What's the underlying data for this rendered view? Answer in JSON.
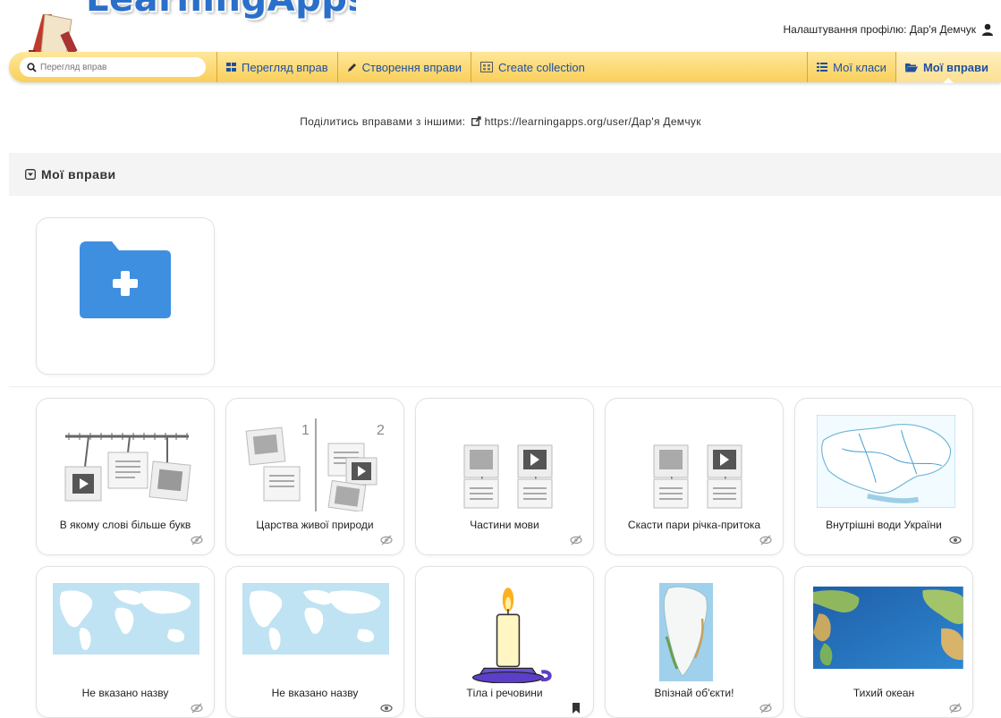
{
  "header": {
    "logo_text": "LearningApps.org",
    "profile_label": "Налаштування профілю: Дар'я Демчук"
  },
  "nav": {
    "search_placeholder": "Перегляд вправ",
    "items": [
      {
        "label": "Перегляд вправ",
        "icon": "grid-icon"
      },
      {
        "label": "Створення вправи",
        "icon": "pencil-icon"
      },
      {
        "label": "Create collection",
        "icon": "collection-icon"
      },
      {
        "label": "Мої класи",
        "icon": "list-icon"
      },
      {
        "label": "Мої вправи",
        "icon": "folder-open-icon",
        "active": true
      }
    ]
  },
  "share": {
    "text": "Поділитись вправами з іншими:",
    "url": "https://learningapps.org/user/Дар'я Демчук"
  },
  "section": {
    "title": "Мої вправи"
  },
  "cards": [
    {
      "title": "В якому слові більше букв",
      "status": "eye-hidden-icon",
      "thumb": "timeline"
    },
    {
      "title": "Царства живої природи",
      "status": "eye-hidden-icon",
      "thumb": "groups"
    },
    {
      "title": "Частини мови",
      "status": "eye-hidden-icon",
      "thumb": "pairs"
    },
    {
      "title": "Скасти пари річка-притока",
      "status": "eye-hidden-icon",
      "thumb": "pairs"
    },
    {
      "title": "Внутрішні води України",
      "status": "eye-icon",
      "thumb": "map-ukraine"
    },
    {
      "title": "Не вказано назву",
      "status": "eye-hidden-icon",
      "thumb": "world-map"
    },
    {
      "title": "Не вказано назву",
      "status": "eye-icon",
      "thumb": "world-map"
    },
    {
      "title": "Тіла і речовини",
      "status": "bookmark-icon",
      "thumb": "candle"
    },
    {
      "title": "Впізнай об'єкти!",
      "status": "eye-hidden-icon",
      "thumb": "greenland"
    },
    {
      "title": "Тихий океан",
      "status": "eye-hidden-icon",
      "thumb": "physical-map"
    }
  ],
  "colors": {
    "brand_blue": "#2a6fc9",
    "nav_yellow": "#f9cf5a",
    "folder_blue": "#3f8fe0",
    "map_water": "#bfe3f2"
  }
}
